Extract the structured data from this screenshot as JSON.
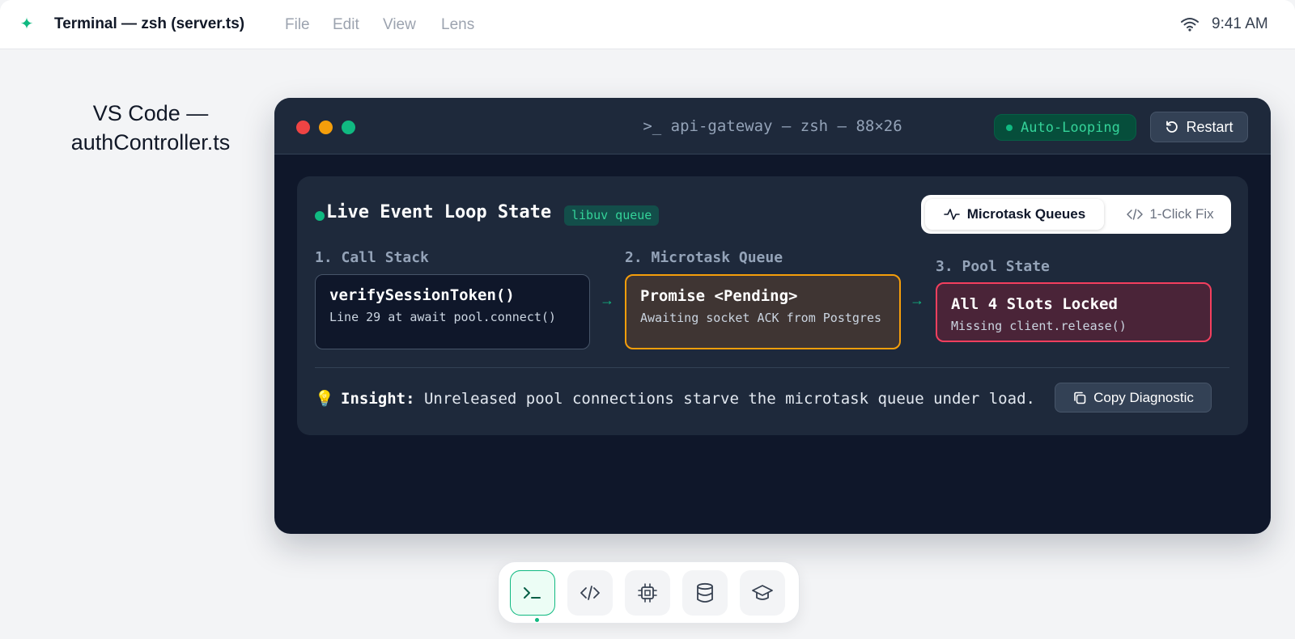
{
  "menubar": {
    "app_title": "Terminal — zsh (server.ts)",
    "menus": [
      "File",
      "Edit",
      "View",
      "Lens"
    ],
    "clock": "9:41 AM",
    "logo_icon": "sparkle-icon",
    "wifi_icon": "wifi-icon"
  },
  "background": {
    "label_line1": "VS Code —",
    "label_line2": "authController.ts"
  },
  "terminal": {
    "title": ">_ api-gateway — zsh — 88×26",
    "status_badge": "Auto-Looping",
    "restart_label": "Restart",
    "traffic_lights": [
      "#ef4444",
      "#f59e0b",
      "#10b981"
    ]
  },
  "panel": {
    "title": "Live Event Loop State",
    "badge": "libuv queue",
    "tabs": {
      "active": "Microtask Queues",
      "inactive": "1-Click Fix"
    },
    "columns": [
      {
        "label": "1. Call Stack",
        "title": "verifySessionToken()",
        "subtitle": "Line 29 at await pool.connect()"
      },
      {
        "label": "2. Microtask Queue",
        "title": "Promise <Pending>",
        "subtitle": "Awaiting socket ACK from Postgres"
      },
      {
        "label": "3. Pool State",
        "title": "All 4 Slots Locked",
        "subtitle": "Missing client.release()"
      }
    ],
    "arrow": "→",
    "insight_icon": "💡",
    "insight_label": "Insight:",
    "insight_text": "Unreleased pool connections starve the microtask queue under load.",
    "copy_label": "Copy Diagnostic"
  },
  "dock": {
    "items": [
      "terminal-icon",
      "code-icon",
      "cpu-icon",
      "database-icon",
      "graduation-cap-icon"
    ],
    "active_index": 0
  },
  "colors": {
    "accent": "#10b981",
    "warning": "#f59e0b",
    "danger": "#f43f5e"
  }
}
